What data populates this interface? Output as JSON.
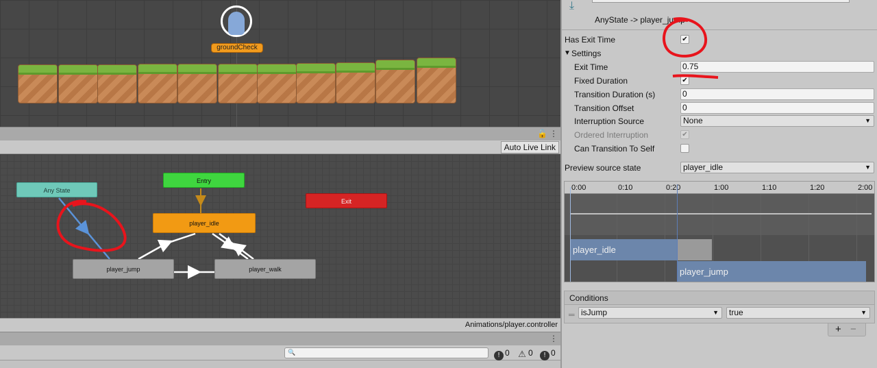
{
  "scene": {
    "player_label": "groundCheck",
    "tile_count": 11
  },
  "animator": {
    "auto_live_link_label": "Auto Live Link",
    "footer_path": "Animations/player.controller",
    "states": {
      "any": "Any State",
      "entry": "Entry",
      "exit": "Exit",
      "idle": "player_idle",
      "jump": "player_jump",
      "walk": "player_walk"
    }
  },
  "console": {
    "error_count": "0",
    "warning_count": "0",
    "info_count": "0"
  },
  "inspector": {
    "transition_title": "AnyState -> player_jump",
    "has_exit_time_label": "Has Exit Time",
    "has_exit_time_checked": "✔",
    "settings_label": "Settings",
    "settings_arrow": "▼",
    "exit_time_label": "Exit Time",
    "exit_time_value": "0.75",
    "fixed_duration_label": "Fixed Duration",
    "fixed_duration_checked": "✔",
    "transition_duration_label": "Transition Duration (s)",
    "transition_duration_value": "0",
    "transition_offset_label": "Transition Offset",
    "transition_offset_value": "0",
    "interruption_source_label": "Interruption Source",
    "interruption_source_value": "None",
    "ordered_interruption_label": "Ordered Interruption",
    "ordered_interruption_checked": "✔",
    "can_transition_to_self_label": "Can Transition To Self",
    "preview_source_state_label": "Preview source state",
    "preview_source_state_value": "player_idle",
    "timeline": {
      "ticks": [
        "0:00",
        "0:10",
        "0:20",
        "1:00",
        "1:10",
        "1:20",
        "2:00"
      ],
      "clip_source": "player_idle",
      "clip_destination": "player_jump"
    },
    "conditions": {
      "header": "Conditions",
      "parameter": "isJump",
      "value": "true",
      "add_label": "+",
      "remove_label": "−"
    }
  },
  "colors": {
    "any_state": "#6fc9b9",
    "entry": "#3fd63f",
    "exit": "#d62424",
    "default_state": "#f29a13",
    "annotation_red": "#e8141c"
  }
}
